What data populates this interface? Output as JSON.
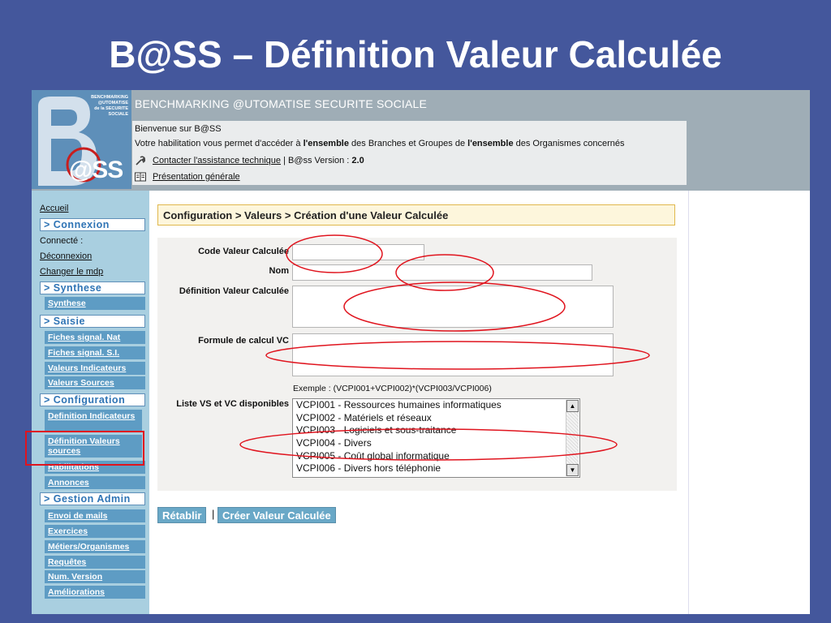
{
  "slide": {
    "title": "B@SS – Définition Valeur Calculée"
  },
  "header": {
    "logo_small_lines": [
      "BENCHMARKING",
      "@UTOMATISE",
      "de la SECURITE",
      "SOCIALE"
    ],
    "logo_text": "@SS",
    "app_name": "BENCHMARKING @UTOMATISE SECURITE SOCIALE",
    "welcome": "Bienvenue sur B@SS",
    "habilitation_pre": "Votre habilitation vous permet d'accéder à ",
    "habilitation_b1": "l'ensemble",
    "habilitation_mid": " des Branches et Groupes de ",
    "habilitation_b2": "l'ensemble",
    "habilitation_post": " des Organismes concernés",
    "contact_link": "Contacter l'assistance technique",
    "version_sep": " | B@ss Version : ",
    "version": "2.0",
    "presentation_link": "Présentation générale"
  },
  "sidebar": {
    "accueil": "Accueil",
    "connexion": {
      "title": "> Connexion",
      "connecte": "Connecté :",
      "deconnexion": "Déconnexion",
      "changer_mdp": "Changer le mdp"
    },
    "synthese": {
      "title": "> Synthese",
      "items": [
        "Synthese"
      ]
    },
    "saisie": {
      "title": "> Saisie",
      "items": [
        "Fiches signal. Nat",
        "Fiches signal. S.I.",
        "Valeurs Indicateurs",
        "Valeurs Sources"
      ]
    },
    "configuration": {
      "title": "> Configuration",
      "items": [
        "Definition Indicateurs",
        "Définition Valeurs sources",
        "Habilitations",
        "Annonces"
      ]
    },
    "gestion": {
      "title": "> Gestion Admin",
      "items": [
        "Envoi de mails",
        "Exercices",
        "Métiers/Organismes",
        "Requêtes",
        "Num. Version",
        "Améliorations"
      ]
    }
  },
  "main": {
    "breadcrumb": "Configuration > Valeurs > Création d'une Valeur Calculée",
    "form": {
      "code_label": "Code Valeur Calculée",
      "code_value": "",
      "nom_label": "Nom",
      "nom_value": "",
      "definition_label": "Définition Valeur Calculée",
      "definition_value": "",
      "formule_label": "Formule de calcul VC",
      "formule_value": "",
      "example": "Exemple : (VCPI001+VCPI002)*(VCPI003/VCPI006)",
      "liste_label": "Liste VS et VC disponibles",
      "liste_options": [
        "VCPI001 - Ressources humaines informatiques",
        "VCPI002 - Matériels et réseaux",
        "VCPI003 - Logiciels et sous-traitance",
        "VCPI004 - Divers",
        "VCPI005 - Coût global informatique",
        "VCPI006 - Divers hors téléphonie"
      ]
    },
    "buttons": {
      "retablir": "Rétablir",
      "separator": "|",
      "creer": "Créer Valeur Calculée"
    }
  },
  "colors": {
    "background": "#44579c",
    "sidebar": "#a9cfe0",
    "sidebar_sub": "#5e9cc4",
    "annotation_red": "#e0141e"
  }
}
